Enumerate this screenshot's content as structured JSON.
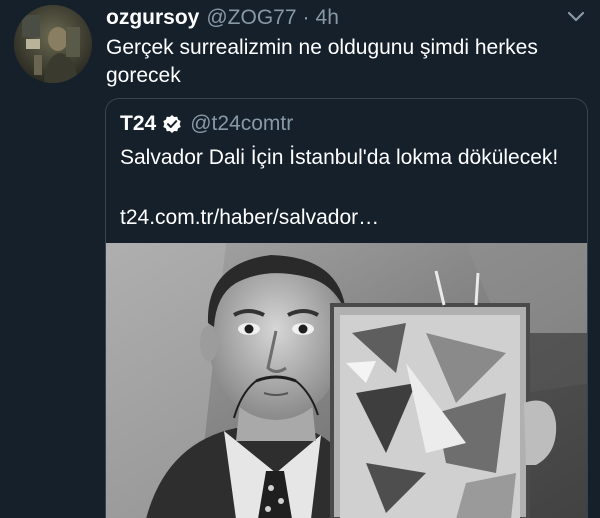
{
  "tweet": {
    "display_name": "ozgursoy",
    "handle": "@ZOG77",
    "separator": "·",
    "time": "4h",
    "text": "Gerçek surrealizmin ne oldugunu şimdi  herkes gorecek",
    "avatar_icon": "user-avatar",
    "menu_icon": "chevron-down-icon"
  },
  "quote": {
    "display_name": "T24",
    "verified_icon": "verified-badge-icon",
    "handle": "@t24comtr",
    "text": "Salvador Dali İçin İstanbul'da lokma dökülecek!",
    "link": "t24.com.tr/haber/salvador…",
    "image_alt": "black-and-white photo of a mustached man holding an abstract painting"
  },
  "colors": {
    "background": "#15202b",
    "primary_text": "#ffffff",
    "secondary_text": "#8899a6",
    "card_border": "#38444d"
  }
}
